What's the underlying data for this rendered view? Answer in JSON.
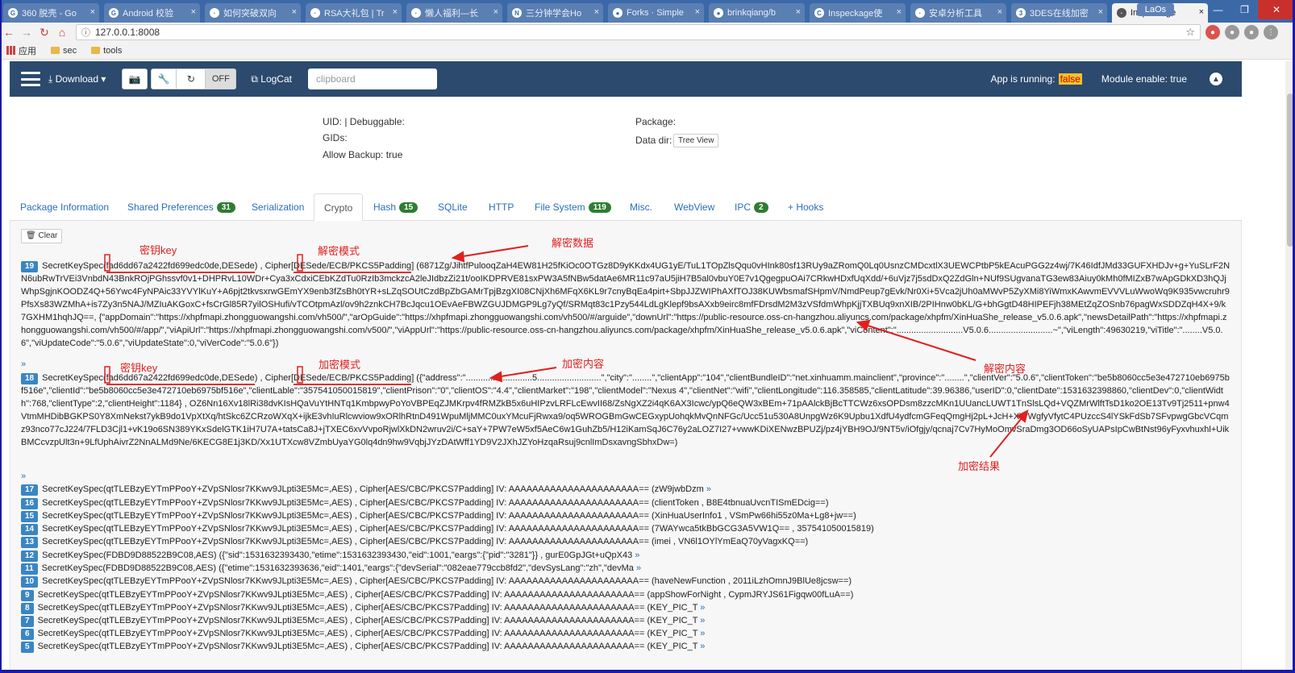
{
  "browser": {
    "tabs": [
      {
        "title": "360 脱壳 - Go",
        "icon": "G"
      },
      {
        "title": "Android 校验",
        "icon": "G"
      },
      {
        "title": "如何突破双向",
        "icon": "·"
      },
      {
        "title": "RSA大礼包 | Tr",
        "icon": "·"
      },
      {
        "title": "懒人福利—长",
        "icon": "·"
      },
      {
        "title": "三分钟学会Ho",
        "icon": "N"
      },
      {
        "title": "Forks · Simple",
        "icon": "●"
      },
      {
        "title": "brinkqiang/b",
        "icon": "●"
      },
      {
        "title": "Inspeckage使",
        "icon": "C"
      },
      {
        "title": "安卓分析工具",
        "icon": "·"
      },
      {
        "title": "3DES在线加密",
        "icon": "3"
      },
      {
        "title": "Inspeckage",
        "icon": "·"
      }
    ],
    "user": "LaOs",
    "url": "127.0.0.1:8008",
    "bookmarks": {
      "apps": "应用",
      "folder1": "sec",
      "folder2": "tools"
    }
  },
  "header": {
    "download": "Download",
    "off": "OFF",
    "logcat": "LogCat",
    "clipboard_placeholder": "clipboard",
    "app_running_label": "App is running:",
    "app_running_value": "false",
    "module_enable": "Module enable: true"
  },
  "info": {
    "uid": "UID: | Debuggable:",
    "gids": "GIDs:",
    "allow_backup": "Allow Backup: true",
    "package": "Package:",
    "data_dir": "Data dir:",
    "tree_view": "Tree View"
  },
  "tabs": [
    {
      "label": "Package Information"
    },
    {
      "label": "Shared Preferences",
      "badge": "31"
    },
    {
      "label": "Serialization"
    },
    {
      "label": "Crypto"
    },
    {
      "label": "Hash",
      "badge": "15"
    },
    {
      "label": "SQLite"
    },
    {
      "label": "HTTP"
    },
    {
      "label": "File System",
      "badge": "119"
    },
    {
      "label": "Misc."
    },
    {
      "label": "WebView"
    },
    {
      "label": "IPC",
      "badge": "2"
    },
    {
      "label": "+ Hooks"
    }
  ],
  "clear": "Clear",
  "crypto": {
    "e19": {
      "num": "19",
      "pre": "SecretKeySpec(",
      "key": "fad6dd67a2422fd699edc0de,DESede",
      "mid": ") , Cipher[",
      "mode": "DESede/ECB/PKCS5Padding",
      "rest": "] (6871Zg/JihtfPulooqZaH4EW81H25fKiOc0OTGz8D9yKKdx4UG1yE/TuL1TOpZlsQqu0vHInk80sf13RUy9aZRomQ0Lq0UsnzCMDcxtlX3UEWCPtbP5kEAcuPGG2z4wj/7K46IdfJMd33GUFXHDJv+g+YuSLrF2NN6ubRwTrVEi3VnbdN43BnkROjPGhssvf0v1+DHPRvL10WDr+Cya3xCdxiCEbKZdTu0RzIb3mckzcA2leJIdbzZi21t/ooIKDPRVE81sxPW3A5fNBw5datAe6MR11c97aU5jiH7B5al0vbuY0E7v1QgegpuOAi7CRkwHDxfUqXdd/+6uVjz7j5sdDxQ2ZdGln+NUf9SUgvanaTG3ew83Aiuy0kMh0fMIZxB7wApGDkXD3hQJjWhpSgjnKOODZ4Q+56Ywc4FyNPAic33YVYlKuY+A6pjt2tkvsxrwGEmYX9enb3fZsBh0tYR+sLZqSOUtCzdBpZbGAMrTpjBzgXI08CNjXh6MFqX6KL9r7cnyBqEa4pirt+SbpJJZWIPhAXfTOJ38KUWbsmafSHpmV/NmdPeup7gEvk/Nr0Xi+5Vca2jUh0aMWvP5ZyXMi8YiWmxKAwvmEVVVLuWwoWq9K935vwcruhr9PfsXs83WZMhA+is7Zy3n5NAJ/MZIuAKGoxC+fsCrGl85R7yilOSHufi/vTCOtpmAzl/ov9h2znkCH7BcJqcu1OEvAeFBWZGUJDMGP9Lg7yQf/SRMqt83c1Pzy544LdLgKlepf9bsAXxb9eirc8mfFDrsdM2M3zVSfdmWhpKjjTXBUq9xnXIB/2PIHnw0bKL/G+bhGgtD48HIPEFjh38MEtZqZOSnb76pagWxSDDZqH4X+9/k7GXHM1hqhJQ==, {\"appDomain\":\"https://xhpfmapi.zhongguowangshi.com/vh500/\",\"arOpGuide\":\"https://xhpfmapi.zhongguowangshi.com/vh500/#/arguide\",\"downUrl\":\"https://public-resource.oss-cn-hangzhou.aliyuncs.com/package/xhpfm/XinHuaShe_release_v5.0.6.apk\",\"newsDetailPath\":\"https://xhpfmapi.zhongguowangshi.com/vh500/#/app/\",\"viApiUrl\":\"https://xhpfmapi.zhongguowangshi.com/v500/\",\"viAppUrl\":\"https://public-resource.oss-cn-hangzhou.aliyuncs.com/package/xhpfm/XinHuaShe_release_v5.0.6.apk\",\"viContent\":\"...........................V5.0.6..........................~\",\"viLength\":49630219,\"viTitle\":\"........V5.0.6\",\"viUpdateCode\":\"5.0.6\",\"viUpdateState\":0,\"viVerCode\":\"5.0.6\"})"
    },
    "e18": {
      "num": "18",
      "pre": "SecretKeySpec(",
      "key": "fad6dd67a2422fd699edc0de,DESede",
      "mid": ") , Cipher[",
      "mode": "DESede/ECB/PKCS5Padding",
      "rest": "] ({\"address\":\"...........................5..........................\",\"city\":\"........\",\"clientApp\":\"104\",\"clientBundleID\":\"net.xinhuamm.mainclient\",\"province\":\"........\",\"clientVer\":\"5.0.6\",\"clientToken\":\"be5b8060cc5e3e472710eb6975bf516e\",\"clientId\":\"be5b8060cc5e3e472710eb6975bf516e\",\"clientLable\":\"357541050015819\",\"clientPrison\":\"0\",\"clientOS\":\"4.4\",\"clientMarket\":\"198\",\"clientModel\":\"Nexus 4\",\"clientNet\":\"wifi\",\"clientLongitude\":116.358585,\"clientLatitude\":39.96386,\"userID\":0,\"clientDate\":1531632398860,\"clientDev\":0,\"clientWidth\":768,\"clientType\":2,\"clientHeight\":1184} , OZ6Nn16Xv18lRi38dvKIsHQaVuYtHNTq1KmbpwyPoYoVBPEqZJMKrpv4fRMZkB5x6uHIPzvLRFLcEwvII68/ZsNgXZ2i4qK6AX3Icwc/ypQ6eQW3xBEm+71pAAlckBjBcTTCWz6xsOPDsm8zzcMKn1UUancLUWT1TnSlsLQd+VQZMrWlftTsD1ko2OE13Tv9Tj2511+pnw4VtmMHDibBGKPS0Y8XmNekst7ykB9do1VpXtXq/htSkc6ZCRzoWXqX+ijkE3vhIuRlcwviow9xORlhRtnD491WpuMljMMC0uxYMcuFjRwxa9/oq5WROGBmGwCEGxypUohqkMvQnNFGc/Ucc51u530A8UnpgWz6K9Upbu1XdfU4ydfcmGFeqQmgHj2pL+JcH+XWWgfyVfytC4PUzccS4lYSkFdSb7SFvpwgGbcVCqmz93nco77cJ224/7FLD3Cjl1+vK19o6SN389YKxSdelGTK1iH7U7A+tatsCa8J+jTXEC6xvVvpoRjwlXkDN2wruv2i/C+saY+7PW7eW5xf5AeC6w1GuhZb5/H12iKamSqJ6C76y2aLOZ7I27+vwwKDiXENwzBPUZj/pz4jYBH9OJ/9NT5v/iOfgjy/qcnaj7Cv7HyMoOmvSraDmg3OD66oSyUAPsIpCwBtNst96yFyxvhuxhl+UikBMCcvzpUlt3n+9LfUphAivrZ2NnALMd9Ne/6KECG8E1j3KD/Xx1UTXcw8VZmbUyaYG0lq4dn9hw9VqbjJYzDAtWff1YD9V2JXhJZYoHzqaRsuj9cnlImDsxavngSbhxDw=)"
    },
    "entries": [
      {
        "num": "17",
        "text": "SecretKeySpec(qtTLEBzyEYTmPPooY+ZVpSNlosr7KKwv9JLpti3E5Mc=,AES) , Cipher[AES/CBC/PKCS7Padding] IV: AAAAAAAAAAAAAAAAAAAAAA== (zW9jwbDzm",
        "more": true
      },
      {
        "num": "16",
        "text": "SecretKeySpec(qtTLEBzyEYTmPPooY+ZVpSNlosr7KKwv9JLpti3E5Mc=,AES) , Cipher[AES/CBC/PKCS7Padding] IV: AAAAAAAAAAAAAAAAAAAAAA== (clientToken , B8E4tbnuaUvcnTISmEDcig==)",
        "more": false
      },
      {
        "num": "15",
        "text": "SecretKeySpec(qtTLEBzyEYTmPPooY+ZVpSNlosr7KKwv9JLpti3E5Mc=,AES) , Cipher[AES/CBC/PKCS7Padding] IV: AAAAAAAAAAAAAAAAAAAAAA== (XinHuaUserInfo1 , VSmPw66hi55z0Ma+Lg8+jw==)",
        "more": false
      },
      {
        "num": "14",
        "text": "SecretKeySpec(qtTLEBzyEYTmPPooY+ZVpSNlosr7KKwv9JLpti3E5Mc=,AES) , Cipher[AES/CBC/PKCS7Padding] IV: AAAAAAAAAAAAAAAAAAAAAA== (7WAYwca5tkBbGCG3A5VW1Q== , 357541050015819)",
        "more": false
      },
      {
        "num": "13",
        "text": "SecretKeySpec(qtTLEBzyEYTmPPooY+ZVpSNlosr7KKwv9JLpti3E5Mc=,AES) , Cipher[AES/CBC/PKCS7Padding] IV: AAAAAAAAAAAAAAAAAAAAAA== (imei , VN6l1OYlYmEaQ70yVagxKQ==)",
        "more": false
      },
      {
        "num": "12",
        "text": "SecretKeySpec(FDBD9D88522B9C08,AES) ({\"sid\":1531632393430,\"etime\":1531632393430,\"eid\":1001,\"eargs\":{\"pid\":\"3281\"}} , gurE0GpJGt+uQpX43",
        "more": true
      },
      {
        "num": "11",
        "text": "SecretKeySpec(FDBD9D88522B9C08,AES) ({\"etime\":1531632393636,\"eid\":1401,\"eargs\":{\"devSerial\":\"082eae779ccb8fd2\",\"devSysLang\":\"zh\",\"devMa",
        "more": true
      },
      {
        "num": "10",
        "text": "SecretKeySpec(qtTLEBzyEYTmPPooY+ZVpSNlosr7KKwv9JLpti3E5Mc=,AES) , Cipher[AES/CBC/PKCS7Padding] IV: AAAAAAAAAAAAAAAAAAAAAA== (haveNewFunction , 2011iLzhOmnJ9BlUe8jcsw==)",
        "more": false
      },
      {
        "num": "9",
        "text": "SecretKeySpec(qtTLEBzyEYTmPPooY+ZVpSNlosr7KKwv9JLpti3E5Mc=,AES) , Cipher[AES/CBC/PKCS7Padding] IV: AAAAAAAAAAAAAAAAAAAAAA== (appShowForNight , CypmJRYJS61Figqw00fLuA==)",
        "more": false
      },
      {
        "num": "8",
        "text": "SecretKeySpec(qtTLEBzyEYTmPPooY+ZVpSNlosr7KKwv9JLpti3E5Mc=,AES) , Cipher[AES/CBC/PKCS7Padding] IV: AAAAAAAAAAAAAAAAAAAAAA== (KEY_PIC_T",
        "more": true
      },
      {
        "num": "7",
        "text": "SecretKeySpec(qtTLEBzyEYTmPPooY+ZVpSNlosr7KKwv9JLpti3E5Mc=,AES) , Cipher[AES/CBC/PKCS7Padding] IV: AAAAAAAAAAAAAAAAAAAAAA== (KEY_PIC_T",
        "more": true
      },
      {
        "num": "6",
        "text": "SecretKeySpec(qtTLEBzyEYTmPPooY+ZVpSNlosr7KKwv9JLpti3E5Mc=,AES) , Cipher[AES/CBC/PKCS7Padding] IV: AAAAAAAAAAAAAAAAAAAAAA== (KEY_PIC_T",
        "more": true
      },
      {
        "num": "5",
        "text": "SecretKeySpec(qtTLEBzyEYTmPPooY+ZVpSNlosr7KKwv9JLpti3E5Mc=,AES) , Cipher[AES/CBC/PKCS7Padding] IV: AAAAAAAAAAAAAAAAAAAAAA== (KEY_PIC_T",
        "more": true
      }
    ]
  },
  "annotations": {
    "key1": "密钥key",
    "mode1": "解密模式",
    "data1": "解密数据",
    "content1": "解密内容",
    "key2": "密钥key",
    "mode2": "加密模式",
    "content2": "加密内容",
    "result2": "加密结果",
    "color": "#e02020"
  },
  "more_glyph": "»"
}
